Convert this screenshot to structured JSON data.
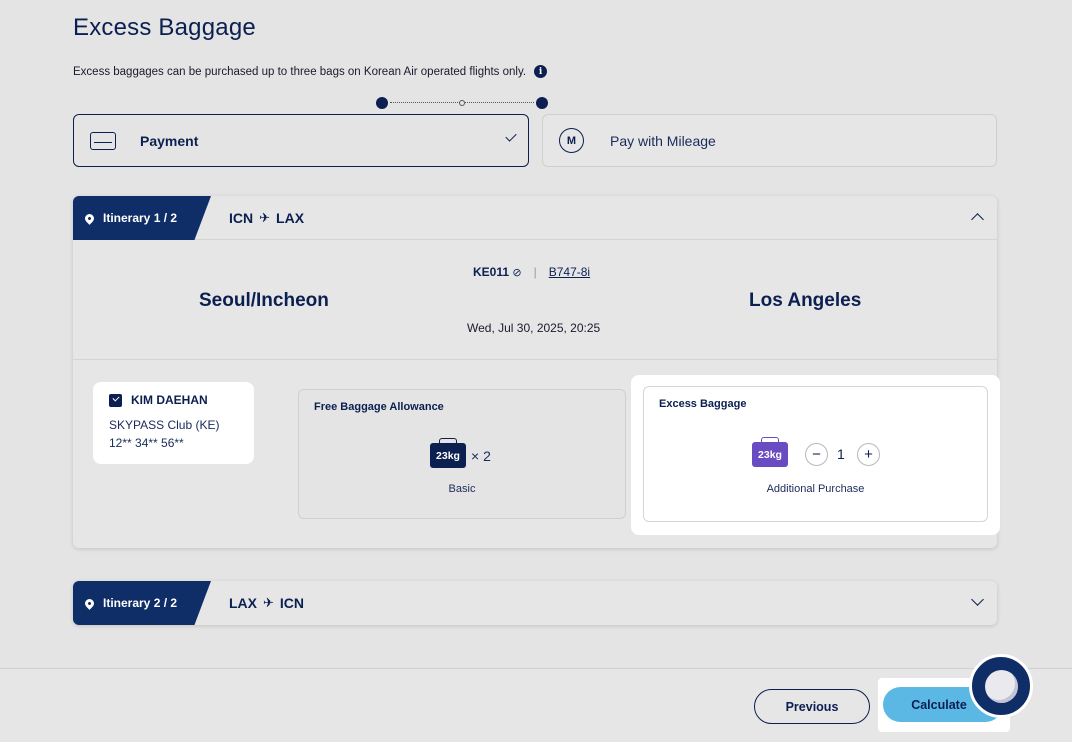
{
  "page": {
    "title": "Excess Baggage",
    "subtitle": "Excess baggages can be purchased up to three bags on Korean Air operated flights only.",
    "info_icon": "i"
  },
  "payment_options": {
    "payment_label": "Payment",
    "mileage_label": "Pay with Mileage",
    "mileage_icon_text": "M"
  },
  "itinerary_1": {
    "tab_label": "Itinerary 1 / 2",
    "origin_code": "ICN",
    "dest_code": "LAX",
    "flight_number": "KE011",
    "codeshare_icon": "⊘",
    "aircraft": "B747-8i",
    "origin_city": "Seoul/Incheon",
    "dest_city": "Los Angeles",
    "departure": "Wed, Jul 30, 2025, 20:25"
  },
  "passenger": {
    "name": "KIM DAEHAN",
    "membership": "SKYPASS Club (KE)",
    "number": "12** 34** 56**"
  },
  "free_baggage": {
    "title": "Free Baggage Allowance",
    "weight": "23kg",
    "count": "× 2",
    "caption": "Basic"
  },
  "excess_baggage": {
    "title": "Excess Baggage",
    "weight": "23kg",
    "minus": "−",
    "quantity": "1",
    "plus": "+",
    "caption": "Additional Purchase"
  },
  "itinerary_2": {
    "tab_label": "Itinerary 2 / 2",
    "origin_code": "LAX",
    "dest_code": "ICN"
  },
  "plane_glyph": "✈",
  "footer": {
    "previous_label": "Previous",
    "calculate_label": "Calculate"
  },
  "colors": {
    "navy": "#0b1f50",
    "tab_navy": "#0f2d66",
    "bag_purple": "#6a4cc2",
    "calculate_blue": "#5bb7e4"
  }
}
